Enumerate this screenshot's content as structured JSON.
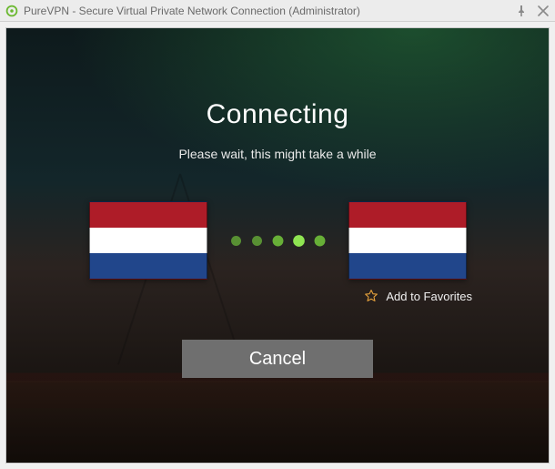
{
  "window": {
    "title": "PureVPN - Secure Virtual Private Network Connection (Administrator)"
  },
  "status": {
    "title": "Connecting",
    "subtitle": "Please wait, this might take a while"
  },
  "flags": {
    "from_country": "Netherlands",
    "to_country": "Netherlands"
  },
  "favorites": {
    "label": "Add to Favorites"
  },
  "actions": {
    "cancel_label": "Cancel"
  },
  "icons": {
    "logo": "purevpn-logo",
    "pin": "pin-icon",
    "close": "close-icon",
    "star": "star-outline-icon"
  },
  "colors": {
    "accent_green": "#6fbf3a",
    "button_bg": "#6f6f6f",
    "flag_red": "#AE1C28",
    "flag_white": "#FFFFFF",
    "flag_blue": "#21468B"
  }
}
